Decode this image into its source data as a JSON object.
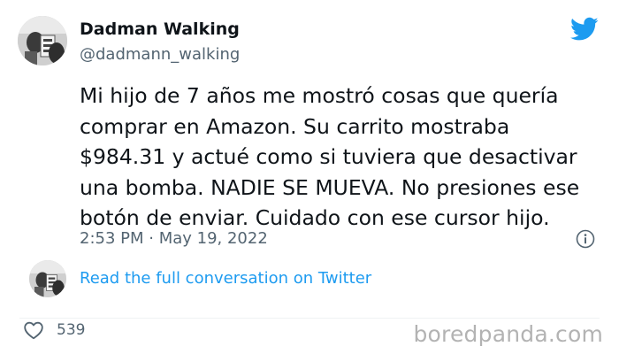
{
  "tweet": {
    "display_name": "Dadman Walking",
    "handle": "@dadmann_walking",
    "text_lines": [
      "Mi hijo de 7 años me mostró cosas que quería",
      "comprar en Amazon. Su carrito mostraba",
      "$984.31 y actué como si tuviera que desactivar",
      "una bomba. NADIE SE MUEVA. No presiones ese",
      "botón de enviar. Cuidado con ese cursor hijo."
    ],
    "timestamp": "2:53 PM · May 19, 2022",
    "read_full_conversation": "Read the full conversation on Twitter",
    "like_count": "539"
  },
  "watermark": "boredpanda.com",
  "colors": {
    "twitter_blue": "#1d9bf0",
    "text_primary": "#0f1419",
    "text_secondary": "#536471",
    "watermark_gray": "#b3b3b3"
  },
  "icons": {
    "logo": "twitter-bird-icon",
    "info": "info-icon",
    "like": "heart-icon"
  }
}
